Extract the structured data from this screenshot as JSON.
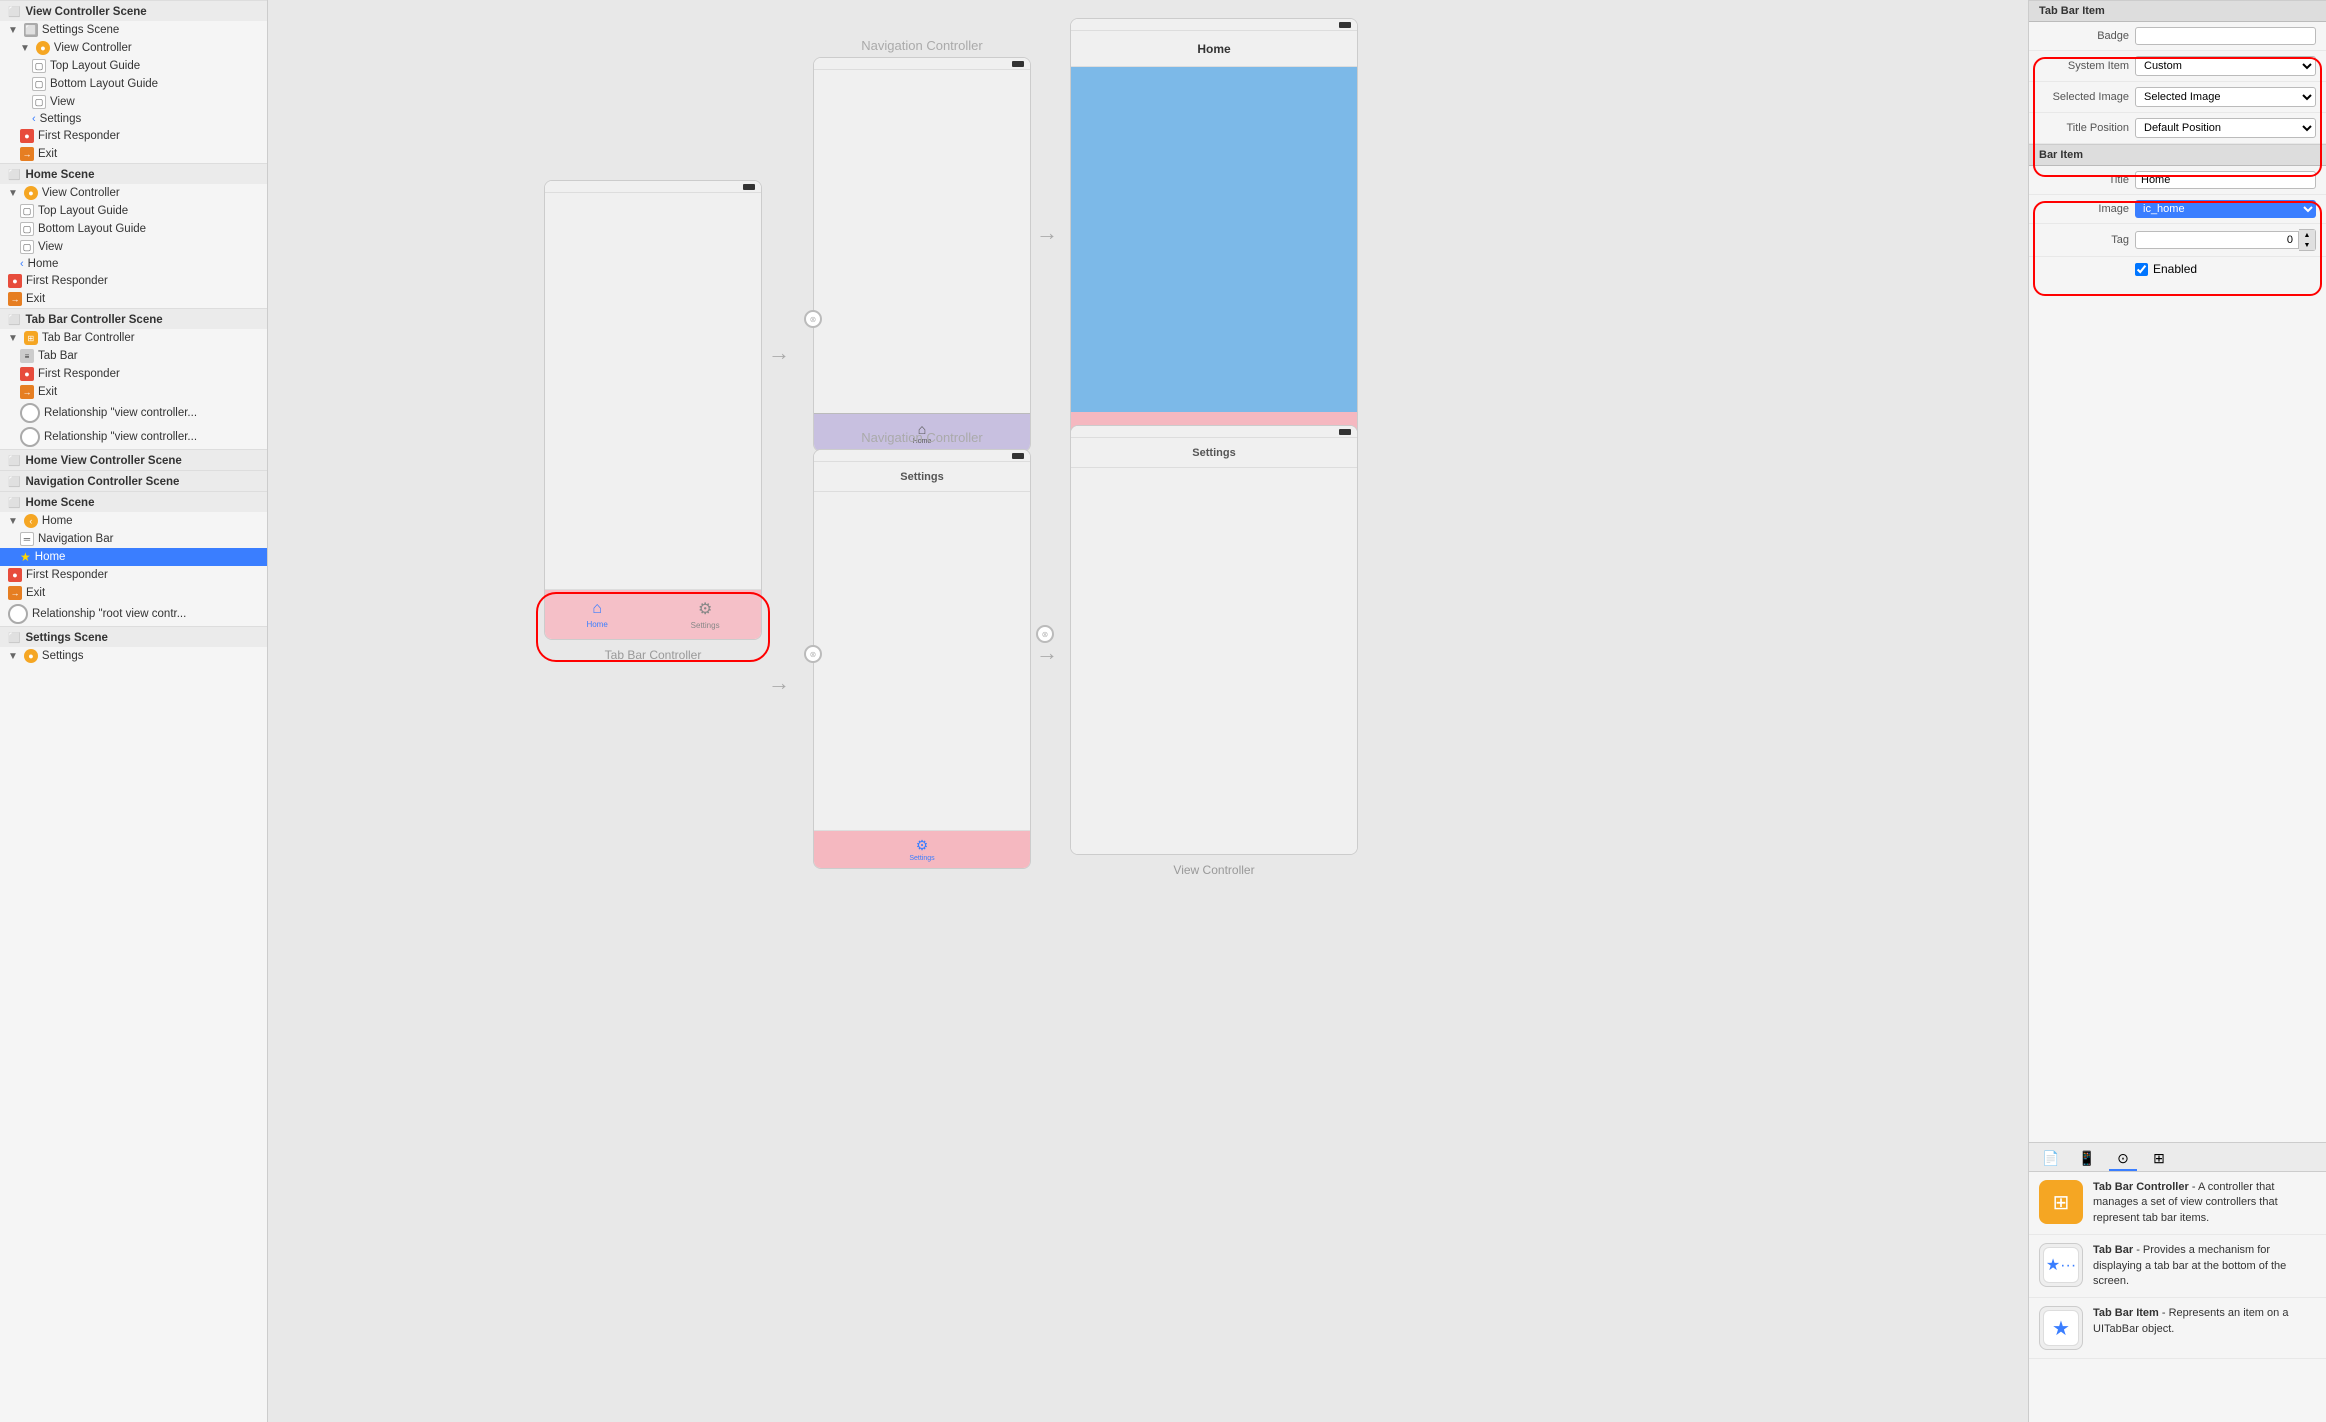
{
  "left_panel": {
    "scenes": [
      {
        "name": "View Controller Scene",
        "items": [
          {
            "indent": 0,
            "type": "scene-header",
            "label": "View Controller Scene"
          },
          {
            "indent": 1,
            "type": "disclosure-open",
            "label": "Settings Scene"
          },
          {
            "indent": 2,
            "type": "disclosure-open",
            "icon": "yellow-circle",
            "label": "View Controller"
          },
          {
            "indent": 3,
            "type": "item",
            "icon": "white-box",
            "label": "Top Layout Guide"
          },
          {
            "indent": 3,
            "type": "item",
            "icon": "white-box",
            "label": "Bottom Layout Guide"
          },
          {
            "indent": 3,
            "type": "item",
            "icon": "white-box",
            "label": "View"
          },
          {
            "indent": 3,
            "type": "item",
            "icon": "chevron",
            "label": "Settings"
          },
          {
            "indent": 2,
            "type": "item",
            "icon": "red-cube",
            "label": "First Responder"
          },
          {
            "indent": 2,
            "type": "item",
            "icon": "orange-exit",
            "label": "Exit"
          }
        ]
      },
      {
        "name": "Home Scene",
        "items": [
          {
            "indent": 0,
            "type": "scene-header",
            "label": "Home Scene"
          },
          {
            "indent": 1,
            "type": "disclosure-open",
            "icon": "yellow-circle",
            "label": "View Controller"
          },
          {
            "indent": 2,
            "type": "item",
            "icon": "white-box",
            "label": "Top Layout Guide"
          },
          {
            "indent": 2,
            "type": "item",
            "icon": "white-box",
            "label": "Bottom Layout Guide"
          },
          {
            "indent": 2,
            "type": "item",
            "icon": "white-box",
            "label": "View"
          },
          {
            "indent": 2,
            "type": "item",
            "icon": "chevron",
            "label": "Home"
          },
          {
            "indent": 1,
            "type": "item",
            "icon": "red-cube",
            "label": "First Responder"
          },
          {
            "indent": 1,
            "type": "item",
            "icon": "orange-exit",
            "label": "Exit"
          }
        ]
      },
      {
        "name": "Tab Bar Controller Scene",
        "items": [
          {
            "indent": 0,
            "type": "scene-header",
            "label": "Tab Bar Controller Scene"
          },
          {
            "indent": 1,
            "type": "disclosure-open",
            "icon": "tab-icon",
            "label": "Tab Bar Controller"
          },
          {
            "indent": 2,
            "type": "item",
            "icon": "tab-bar-icon",
            "label": "Tab Bar"
          },
          {
            "indent": 2,
            "type": "item",
            "icon": "red-cube",
            "label": "First Responder"
          },
          {
            "indent": 2,
            "type": "item",
            "icon": "orange-exit",
            "label": "Exit"
          },
          {
            "indent": 2,
            "type": "item",
            "icon": "dot",
            "label": "Relationship \"view controller..."
          },
          {
            "indent": 2,
            "type": "item",
            "icon": "dot",
            "label": "Relationship \"view controller..."
          }
        ]
      },
      {
        "name": "Home View Controller Scene",
        "items": [
          {
            "indent": 0,
            "type": "scene-header",
            "label": "Home View Controller Scene"
          }
        ]
      },
      {
        "name": "Navigation Controller Scene",
        "items": [
          {
            "indent": 0,
            "type": "scene-header",
            "label": "Navigation Controller Scene"
          }
        ]
      },
      {
        "name": "Home Scene 2",
        "items": [
          {
            "indent": 0,
            "type": "scene-header",
            "label": "Home Scene"
          },
          {
            "indent": 1,
            "type": "disclosure-open",
            "icon": "yellow-back",
            "label": "Home"
          },
          {
            "indent": 2,
            "type": "item",
            "icon": "nav-bar-icon",
            "label": "Navigation Bar"
          },
          {
            "indent": 2,
            "type": "item",
            "icon": "star-blue",
            "label": "Home",
            "selected": true
          },
          {
            "indent": 1,
            "type": "item",
            "icon": "red-cube",
            "label": "First Responder"
          },
          {
            "indent": 1,
            "type": "item",
            "icon": "orange-exit",
            "label": "Exit"
          },
          {
            "indent": 1,
            "type": "item",
            "icon": "dot",
            "label": "Relationship \"root view contr..."
          }
        ]
      },
      {
        "name": "Settings Scene 2",
        "items": [
          {
            "indent": 0,
            "type": "scene-header",
            "label": "Settings Scene"
          },
          {
            "indent": 1,
            "type": "disclosure-open",
            "icon": "yellow-circle",
            "label": "Settings"
          }
        ]
      }
    ]
  },
  "right_panel": {
    "tab_bar_item_section": {
      "title": "Tab Bar Item",
      "badge_label": "Badge",
      "badge_value": "",
      "system_item_label": "System Item",
      "system_item_value": "Custom",
      "selected_image_label": "Selected Image",
      "selected_image_value": "Selected Image",
      "title_position_label": "Title Position",
      "title_position_value": "Default Position"
    },
    "bar_item_section": {
      "title": "Bar Item",
      "title_label": "Title",
      "title_value": "Home",
      "image_label": "Image",
      "image_value": "ic_home",
      "tag_label": "Tag",
      "tag_value": "0",
      "enabled_label": "Enabled"
    },
    "bottom_tabs": [
      "document-icon",
      "phone-icon",
      "circle-icon",
      "grid-icon"
    ],
    "info_items": [
      {
        "icon_type": "tab-bar-controller",
        "title": "Tab Bar Controller",
        "description": " - A controller that manages a set of view controllers that represent tab bar items."
      },
      {
        "icon_type": "tab-bar",
        "title": "Tab Bar",
        "description": " - Provides a mechanism for displaying a tab bar at the bottom of the screen."
      },
      {
        "icon_type": "tab-bar-item",
        "title": "Tab Bar Item",
        "description": " - Represents an item on a UITabBar object."
      }
    ]
  },
  "canvas": {
    "tab_bar_controller_label": "Tab Bar Controller",
    "nav_controller_top_label": "Navigation Controller",
    "nav_controller_bottom_label": "Navigation Controller",
    "home_nav_title": "Home",
    "settings_nav_title": "Settings",
    "vc_settings_title": "Settings",
    "vc_title": "View Controller",
    "home_tab_label": "Home",
    "settings_tab_label": "Settings"
  }
}
